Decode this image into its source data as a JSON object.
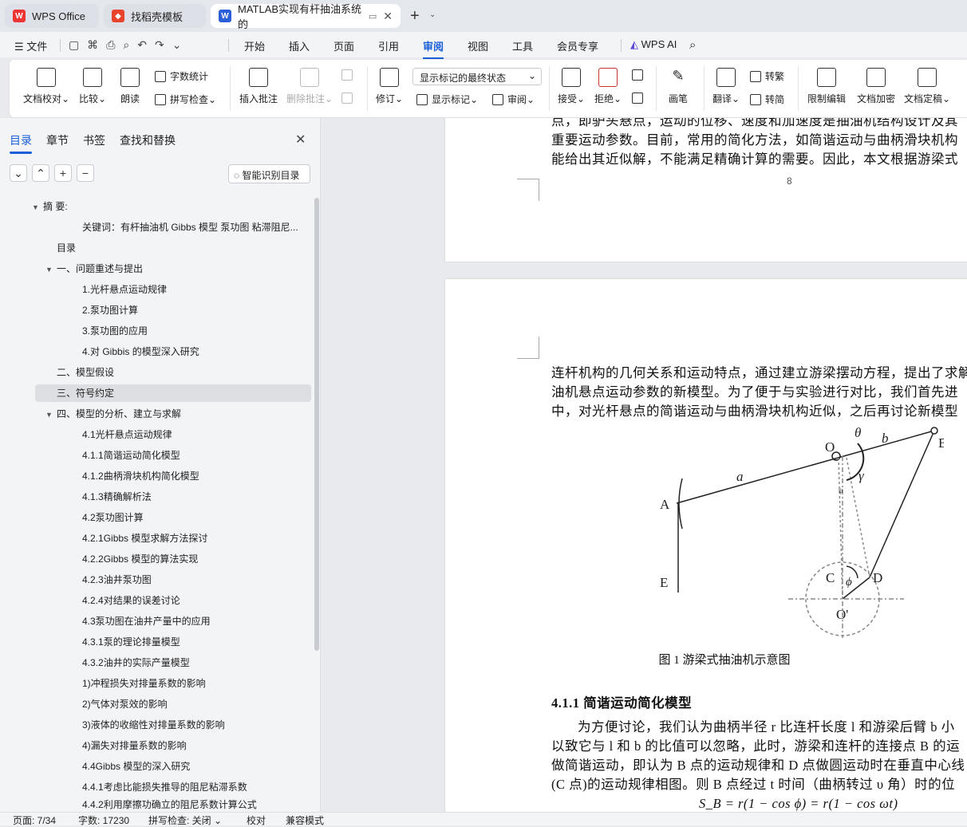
{
  "tabs": [
    {
      "label": "WPS Office"
    },
    {
      "label": "找稻壳模板"
    },
    {
      "label": "MATLAB实现有杆抽油系统的"
    }
  ],
  "menu": {
    "file": "文件",
    "items": [
      "开始",
      "插入",
      "页面",
      "引用",
      "审阅",
      "视图",
      "工具",
      "会员专享"
    ],
    "ai": "WPS AI"
  },
  "ribbon": {
    "proof": "文档校对",
    "compare": "比较",
    "read": "朗读",
    "wordcount": "字数统计",
    "spell": "拼写检查",
    "insert_comment": "插入批注",
    "delete_comment": "删除批注",
    "revise": "修订",
    "show_state": "显示标记的最终状态",
    "show_marks": "显示标记",
    "review": "审阅",
    "accept": "接受",
    "reject": "拒绝",
    "pen": "画笔",
    "translate": "翻译",
    "to_trad": "转繁",
    "to_simp": "转简",
    "restrict": "限制编辑",
    "encrypt": "文档加密",
    "finalize": "文档定稿"
  },
  "sidebar": {
    "tabs": [
      "目录",
      "章节",
      "书签",
      "查找和替换"
    ],
    "smart": "智能识别目录",
    "toc": [
      "摘 要:",
      "关键词：有杆抽油机 Gibbs 模型 泵功图 粘滞阻尼...",
      "目录",
      "一、问题重述与提出",
      "1.光杆悬点运动规律",
      "2.泵功图计算",
      "3.泵功图的应用",
      "4.对 Gibbis 的模型深入研究",
      "二、模型假设",
      "三、符号约定",
      "四、模型的分析、建立与求解",
      "4.1光杆悬点运动规律",
      "4.1.1简谐运动简化模型",
      "4.1.2曲柄滑块机构简化模型",
      "4.1.3精确解析法",
      "4.2泵功图计算",
      "4.2.1Gibbs 模型求解方法探讨",
      "4.2.2Gibbs 模型的算法实现",
      "4.2.3油井泵功图",
      "4.2.4对结果的误差讨论",
      "4.3泵功图在油井产量中的应用",
      "4.3.1泵的理论排量模型",
      "4.3.2油井的实际产量模型",
      "1)冲程损失对排量系数的影响",
      "2)气体对泵效的影响",
      "3)液体的收缩性对排量系数的影响",
      "4)漏失对排量系数的影响",
      "4.4Gibbs 模型的深入研究",
      "4.4.1考虑比能损失推导的阻尼粘滞系数",
      "4.4.2利用摩擦功确立的阻尼系数计算公式"
    ]
  },
  "doc": {
    "p1": [
      "点，即驴头悬点，运动的位移、速度和加速度是抽油机结构设计及其",
      "重要运动参数。目前，常用的简化方法，如简谐运动与曲柄滑块机构",
      "能给出其近似解，不能满足精确计算的需要。因此，本文根据游梁式"
    ],
    "page_num": "8",
    "p2": [
      "连杆机构的几何关系和运动特点，通过建立游梁摆动方程，提出了求解",
      "油机悬点运动参数的新模型。为了便于与实验进行对比，我们首先进",
      "中，对光杆悬点的简谐运动与曲柄滑块机构近似，之后再讨论新模型"
    ],
    "fig": {
      "A": "A",
      "B": "B",
      "O": "O",
      "E": "E",
      "C": "C",
      "D": "D",
      "O2": "O'",
      "a": "a",
      "b": "b",
      "theta": "θ",
      "gamma": "γ",
      "phi": "ϕ",
      "psi": "ψ"
    },
    "caption": "图 1 游梁式抽油机示意图",
    "heading": "4.1.1  简谐运动简化模型",
    "p3": [
      "为方便讨论，我们认为曲柄半径 r 比连杆长度 l 和游梁后臂 b 小",
      "以致它与 l 和 b 的比值可以忽略，此时，游梁和连杆的连接点 B 的运",
      "做简谐运动，即认为 B 点的运动规律和 D 点做圆运动时在垂直中心线",
      "(C 点)的运动规律相图。则 B 点经过 t 时间（曲柄转过 υ 角）时的位"
    ],
    "formula": "S_B = r(1 − cos ϕ) = r(1 − cos ωt)"
  },
  "status": {
    "page": "页面: 7/34",
    "words": "字数: 17230",
    "spell": "拼写检查: 关闭",
    "proof": "校对",
    "compat": "兼容模式"
  }
}
